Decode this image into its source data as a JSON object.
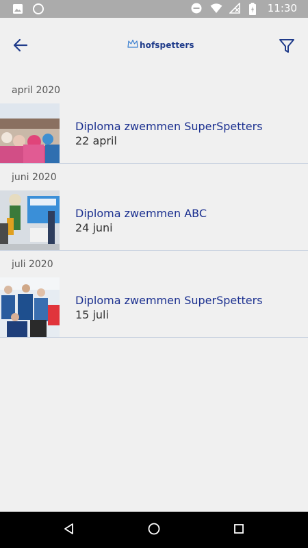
{
  "status_bar": {
    "time": "11:30",
    "icons": [
      "image-icon",
      "circle-icon",
      "do-not-disturb-icon",
      "wifi-icon",
      "no-signal-icon",
      "battery-icon"
    ]
  },
  "app_bar": {
    "logo_text": "hofspetters",
    "back_icon": "arrow-left-icon",
    "filter_icon": "filter-icon",
    "accent_color": "#1f3b8a"
  },
  "sections": [
    {
      "header": "april 2020",
      "items": [
        {
          "title": "Diploma zwemmen SuperSpetters",
          "date": "22 april"
        }
      ]
    },
    {
      "header": "juni 2020",
      "items": [
        {
          "title": "Diploma zwemmen ABC",
          "date": "24 juni"
        }
      ]
    },
    {
      "header": "juli 2020",
      "items": [
        {
          "title": "Diploma zwemmen SuperSpetters",
          "date": "15 juli"
        }
      ]
    }
  ],
  "nav_bar": {
    "icons": [
      "back-triangle-icon",
      "home-circle-icon",
      "recents-square-icon"
    ]
  }
}
